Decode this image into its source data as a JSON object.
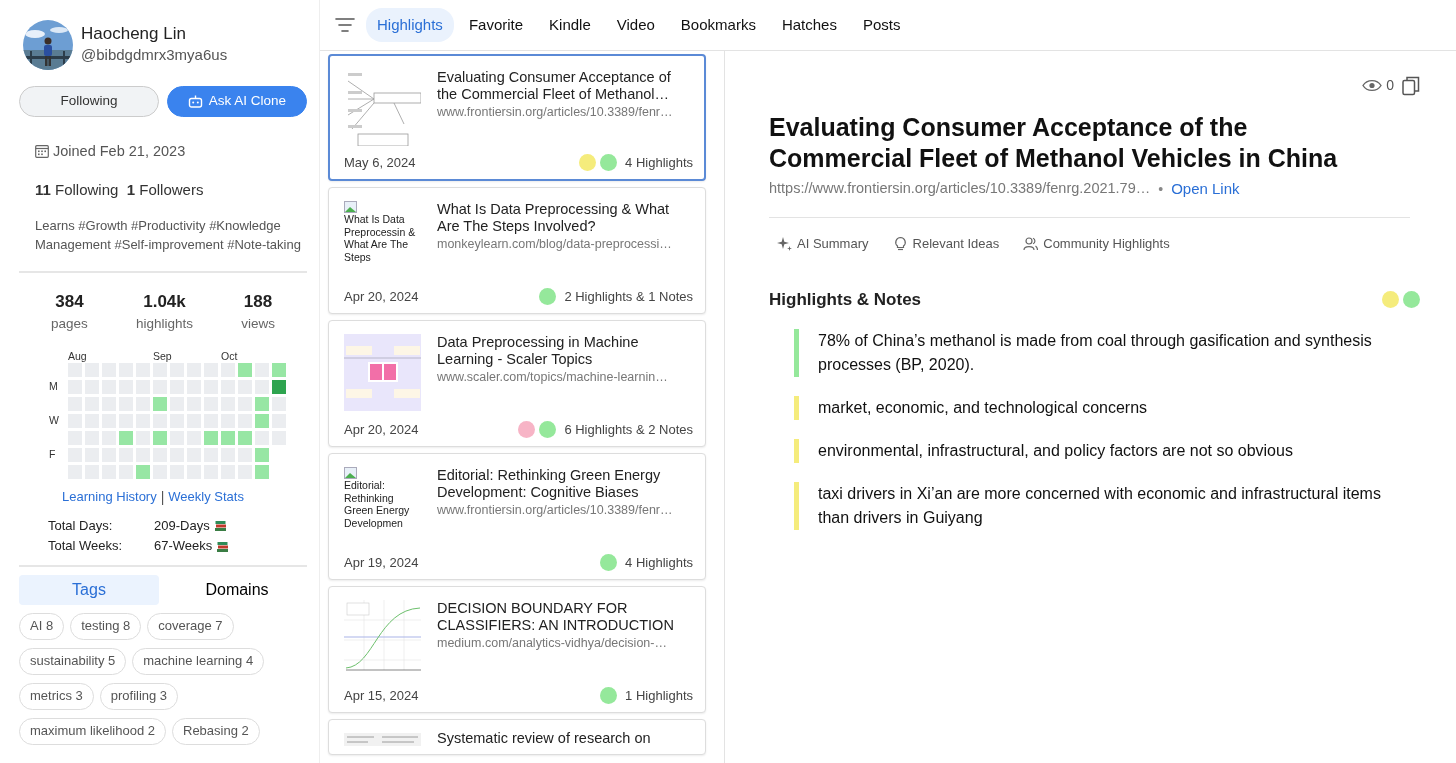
{
  "profile": {
    "name": "Haocheng Lin",
    "handle": "@bibdgdmrx3mya6us",
    "buttons": [
      {
        "label": "Following",
        "kind": "secondary"
      },
      {
        "label": "Ask AI Clone",
        "kind": "primary"
      }
    ],
    "joined": "Joined Feb 21, 2023",
    "follow_counts": "**11** Following  **1** Followers",
    "bio": "Learns #Growth #Productivity #Knowledge Management #Self-improvement #Note-taking"
  },
  "stats": [
    {
      "value": "384",
      "label": "pages"
    },
    {
      "value": "1.04k",
      "label": "highlights"
    },
    {
      "value": "188",
      "label": "views"
    }
  ],
  "activity": {
    "weekday_labels": {
      "mon": "M",
      "wed": "W",
      "fri": "F"
    },
    "weeks": [
      {
        "month": "Aug",
        "days": [
          {
            "color": "#ebedf0"
          },
          {
            "color": "#ebedf0"
          },
          {
            "color": "#ebedf0"
          },
          {
            "color": "#ebedf0"
          },
          {
            "color": "#ebedf0"
          },
          {
            "color": "#ebedf0"
          },
          {
            "color": "#ebedf0"
          }
        ]
      },
      {
        "days": [
          {
            "color": "#ebedf0"
          },
          {
            "color": "#ebedf0"
          },
          {
            "color": "#ebedf0"
          },
          {
            "color": "#ebedf0"
          },
          {
            "color": "#ebedf0"
          },
          {
            "color": "#ebedf0"
          },
          {
            "color": "#ebedf0"
          }
        ]
      },
      {
        "days": [
          {
            "color": "#ebedf0"
          },
          {
            "color": "#ebedf0"
          },
          {
            "color": "#ebedf0"
          },
          {
            "color": "#ebedf0"
          },
          {
            "color": "#ebedf0"
          },
          {
            "color": "#ebedf0"
          },
          {
            "color": "#ebedf0"
          }
        ]
      },
      {
        "days": [
          {
            "color": "#ebedf0"
          },
          {
            "color": "#ebedf0"
          },
          {
            "color": "#ebedf0"
          },
          {
            "color": "#ebedf0"
          },
          {
            "color": "#97e6a4"
          },
          {
            "color": "#ebedf0"
          },
          {
            "color": "#ebedf0"
          }
        ]
      },
      {
        "days": [
          {
            "color": "#ebedf0"
          },
          {
            "color": "#ebedf0"
          },
          {
            "color": "#ebedf0"
          },
          {
            "color": "#ebedf0"
          },
          {
            "color": "#ebedf0"
          },
          {
            "color": "#ebedf0"
          },
          {
            "color": "#97e6a4"
          }
        ]
      },
      {
        "month": "Sep",
        "days": [
          {
            "color": "#ebedf0"
          },
          {
            "color": "#ebedf0"
          },
          {
            "color": "#97e6a4"
          },
          {
            "color": "#ebedf0"
          },
          {
            "color": "#97e6a4"
          },
          {
            "color": "#ebedf0"
          },
          {
            "color": "#ebedf0"
          }
        ]
      },
      {
        "days": [
          {
            "color": "#ebedf0"
          },
          {
            "color": "#ebedf0"
          },
          {
            "color": "#ebedf0"
          },
          {
            "color": "#ebedf0"
          },
          {
            "color": "#ebedf0"
          },
          {
            "color": "#ebedf0"
          },
          {
            "color": "#ebedf0"
          }
        ]
      },
      {
        "days": [
          {
            "color": "#ebedf0"
          },
          {
            "color": "#ebedf0"
          },
          {
            "color": "#ebedf0"
          },
          {
            "color": "#ebedf0"
          },
          {
            "color": "#ebedf0"
          },
          {
            "color": "#ebedf0"
          },
          {
            "color": "#ebedf0"
          }
        ]
      },
      {
        "days": [
          {
            "color": "#ebedf0"
          },
          {
            "color": "#ebedf0"
          },
          {
            "color": "#ebedf0"
          },
          {
            "color": "#ebedf0"
          },
          {
            "color": "#97e6a4"
          },
          {
            "color": "#ebedf0"
          },
          {
            "color": "#ebedf0"
          }
        ]
      },
      {
        "month": "Oct",
        "days": [
          {
            "color": "#ebedf0"
          },
          {
            "color": "#ebedf0"
          },
          {
            "color": "#ebedf0"
          },
          {
            "color": "#ebedf0"
          },
          {
            "color": "#97e6a4"
          },
          {
            "color": "#ebedf0"
          },
          {
            "color": "#ebedf0"
          }
        ]
      },
      {
        "days": [
          {
            "color": "#97e6a4"
          },
          {
            "color": "#ebedf0"
          },
          {
            "color": "#ebedf0"
          },
          {
            "color": "#ebedf0"
          },
          {
            "color": "#97e6a4"
          },
          {
            "color": "#ebedf0"
          },
          {
            "color": "#ebedf0"
          }
        ]
      },
      {
        "days": [
          {
            "color": "#ebedf0"
          },
          {
            "color": "#ebedf0"
          },
          {
            "color": "#97e6a4"
          },
          {
            "color": "#97e6a4"
          },
          {
            "color": "#ebedf0"
          },
          {
            "color": "#97e6a4"
          },
          {
            "color": "#97e6a4"
          }
        ]
      },
      {
        "days": [
          {
            "color": "#97e6a4"
          },
          {
            "color": "#2ea44f"
          },
          {
            "color": "#ebedf0"
          },
          {
            "color": "#ebedf0"
          },
          {
            "color": "#ebedf0"
          }
        ]
      }
    ]
  },
  "links": [
    "Learning History",
    "Weekly Stats"
  ],
  "link_separator": "|",
  "totals": [
    {
      "label": "Total Days:",
      "value": "209-Days"
    },
    {
      "label": "Total Weeks:",
      "value": "67-Weeks"
    }
  ],
  "tag_tabs": [
    {
      "label": "Tags",
      "selected": true
    },
    {
      "label": "Domains",
      "selected": false
    }
  ],
  "tags": [
    "AI 8",
    "testing 8",
    "coverage 7",
    "sustainability 5",
    "machine learning 4",
    "metrics 3",
    "profiling 3",
    "maximum likelihood 2",
    "Rebasing 2"
  ],
  "nav": {
    "tabs": [
      {
        "label": "Highlights",
        "selected": true
      },
      {
        "label": "Favorite",
        "selected": false
      },
      {
        "label": "Kindle",
        "selected": false
      },
      {
        "label": "Video",
        "selected": false
      },
      {
        "label": "Bookmarks",
        "selected": false
      },
      {
        "label": "Hatches",
        "selected": false
      },
      {
        "label": "Posts",
        "selected": false
      }
    ]
  },
  "articles": [
    {
      "selected": true,
      "title": "Evaluating Consumer Acceptance of the Commercial Fleet of Methanol…",
      "url": "www.frontiersin.org/articles/10.3389/fenr…",
      "date": "May 6, 2024",
      "thumbnail": {
        "kind": "diagram"
      },
      "dots": [
        {
          "color": "#f5ec7c"
        },
        {
          "color": "#95e89b"
        }
      ],
      "count": "4 Highlights"
    },
    {
      "selected": false,
      "title": "What Is Data Preprocessing & What Are The Steps Involved?",
      "url": "monkeylearn.com/blog/data-preprocessi…",
      "date": "Apr 20, 2024",
      "thumbnail": {
        "kind": "alt",
        "text": "What Is Data Preprocessin & What Are The Steps"
      },
      "dots": [
        {
          "color": "#95e89b"
        }
      ],
      "count": "2 Highlights & 1 Notes"
    },
    {
      "selected": false,
      "title": "Data Preprocessing in Machine Learning - Scaler Topics",
      "url": "www.scaler.com/topics/machine-learnin…",
      "date": "Apr 20, 2024",
      "thumbnail": {
        "kind": "blocks"
      },
      "dots": [
        {
          "color": "#f7b4c6"
        },
        {
          "color": "#95e89b"
        }
      ],
      "count": "6 Highlights & 2 Notes"
    },
    {
      "selected": false,
      "title": "Editorial: Rethinking Green Energy Development: Cognitive Biases",
      "url": "www.frontiersin.org/articles/10.3389/fenr…",
      "date": "Apr 19, 2024",
      "thumbnail": {
        "kind": "alt",
        "text": "Editorial: Rethinking Green Energy Developmen"
      },
      "dots": [
        {
          "color": "#95e89b"
        }
      ],
      "count": "4 Highlights"
    },
    {
      "selected": false,
      "title": "DECISION BOUNDARY FOR CLASSIFIERS: AN INTRODUCTION",
      "url": "medium.com/analytics-vidhya/decision-…",
      "date": "Apr 15, 2024",
      "thumbnail": {
        "kind": "curve"
      },
      "dots": [
        {
          "color": "#95e89b"
        }
      ],
      "count": "1 Highlights"
    },
    {
      "selected": false,
      "title": "Systematic review of research on",
      "thumbnail": {
        "kind": "diagram"
      }
    }
  ],
  "detail": {
    "views": "0",
    "title": "Evaluating Consumer Acceptance of the Commercial Fleet of Methanol Vehicles in China",
    "url": "https://www.frontiersin.org/articles/10.3389/fenrg.2021.79…",
    "separator": "•",
    "open_link": "Open Link",
    "tools": [
      {
        "label": "AI Summary",
        "kind": "sparkle"
      },
      {
        "label": "Relevant Ideas",
        "kind": "bulb"
      },
      {
        "label": "Community Highlights",
        "kind": "people"
      }
    ],
    "section_title": "Highlights & Notes",
    "section_dots": [
      {
        "color": "#f5ec7c"
      },
      {
        "color": "#95e89b"
      }
    ],
    "highlights": [
      {
        "text": "78% of China’s methanol is made from coal through gasification and synthesis processes (BP, 2020).",
        "color": "#95e89b"
      },
      {
        "text": "market, economic, and technological concerns",
        "color": "#f5ec7c"
      },
      {
        "text": "environmental, infrastructural, and policy factors are not so obvious",
        "color": "#f5ec7c"
      },
      {
        "text": "taxi drivers in Xi’an are more concerned with economic and infrastructural items than drivers in Guiyang",
        "color": "#f5ec7c"
      }
    ]
  }
}
